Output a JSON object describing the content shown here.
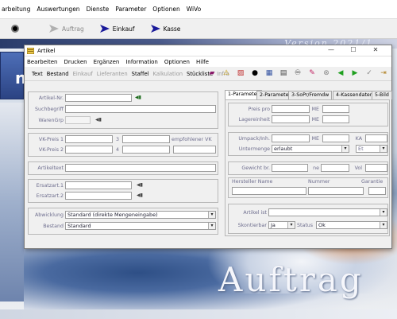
{
  "app": {
    "menu": [
      "arbeitung",
      "Auswertungen",
      "Dienste",
      "Parameter",
      "Optionen",
      "WiVo"
    ],
    "toolbar": {
      "auftrag": "Auftrag",
      "einkauf": "Einkauf",
      "kasse": "Kasse"
    },
    "version": "Version 2021/1",
    "backdrop_word": "Auftrag",
    "logo_letter": "n"
  },
  "window": {
    "title": "Artikel",
    "menu": [
      "Bearbeiten",
      "Drucken",
      "Ergänzen",
      "Information",
      "Optionen",
      "Hilfe"
    ],
    "toolbar_links": [
      {
        "label": "Text",
        "enabled": true
      },
      {
        "label": "Bestand",
        "enabled": true
      },
      {
        "label": "Einkauf",
        "enabled": false
      },
      {
        "label": "Lieferanten",
        "enabled": false
      },
      {
        "label": "Staffel",
        "enabled": true
      },
      {
        "label": "Kalkulation",
        "enabled": false
      },
      {
        "label": "Stückliste",
        "enabled": true
      },
      {
        "label": "Infra",
        "enabled": false
      }
    ]
  },
  "left": {
    "artikel_nr": "Artikel-Nr.",
    "suchbegriff": "Suchbegriff",
    "warengrp": "WarenGrp",
    "vk1": "VK-Preis 1",
    "vk2": "VK-Preis 2",
    "idx3": "3",
    "idx4": "4",
    "empf": "empfohlener VK",
    "artikeltext": "Artikeltext",
    "ersatz1": "Ersatzart.1",
    "ersatz2": "Ersatzart.2",
    "abwicklung": "Abwicklung",
    "abwicklung_value": "Standard (direkte Mengeneingabe)",
    "bestand": "Bestand",
    "bestand_value": "Standard"
  },
  "tabs": [
    "1-Parameter",
    "2-Parameter",
    "3-SoPr/Fremdw",
    "4-Kassendaten",
    "5-Bild"
  ],
  "right": {
    "preis_pro": "Preis pro",
    "me": "ME",
    "lagereinheit": "Lagereinheit",
    "umpack": "Umpack/Inh.",
    "ka": "KA",
    "untermenge": "Untermenge",
    "untermenge_value": "erlaubt",
    "et": "Et",
    "gewicht": "Gewicht br.",
    "ne": "ne",
    "vol": "Vol",
    "hersteller": "Hersteller Name",
    "nummer": "Nummer",
    "garantie": "Garantie",
    "artikel_ist": "Artikel ist",
    "skontierbar": "Skontierbar",
    "skontierbar_value": "Ja",
    "status": "Status",
    "status_value": "Ok"
  }
}
